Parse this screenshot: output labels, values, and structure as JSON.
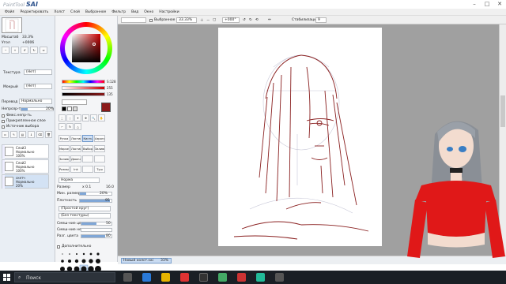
{
  "app": {
    "logo_small": "PaintTool",
    "logo_big": "SAI"
  },
  "window": {
    "minimize": "–",
    "maximize": "□",
    "close": "✕"
  },
  "menu": [
    "Файл",
    "Редактировать",
    "Холст",
    "Слой",
    "Выбранное",
    "Фильтр",
    "Вид",
    "Окно",
    "Настройки"
  ],
  "toolbar": {
    "selection_label": "Выбранное",
    "zoom": "33.33%",
    "rotation": "+000°",
    "stabilizer_label": "Стабилизация",
    "stabilizer_value": "9"
  },
  "navigator": {
    "scale_label": "Масштаб",
    "scale_value": "33.3%",
    "angle_label": "Угол",
    "angle_value": "+0006"
  },
  "texture": {
    "label": "Текстура",
    "value": "(Нет)"
  },
  "effect": {
    "label": "Мокрый",
    "value": "(Нет)"
  },
  "blend": {
    "mode_label": "Перевод",
    "mode_value": "Нормально",
    "opacity_label": "Непрозр-ть",
    "opacity_value": "20%",
    "opacity_level": 0.2
  },
  "checkboxes": {
    "protect": "Фикс.непр-ть",
    "clip": "Прикрепленное слое",
    "selection_source": "Источник выбора"
  },
  "layers": [
    {
      "name": "Слой3",
      "mode": "Нормально",
      "opacity": "100%",
      "selected": false
    },
    {
      "name": "Слой2",
      "mode": "Нормально",
      "opacity": "100%",
      "selected": false
    },
    {
      "name": "скетч",
      "mode": "Нормально",
      "opacity": "20%",
      "selected": true
    }
  ],
  "color": {
    "rgb_values": [
      "S:128",
      "255",
      "135"
    ],
    "current": "#8b1a1a",
    "secondary": "#000000"
  },
  "tools": {
    "row1": [
      "Ручка",
      "Ластик",
      "Кисть",
      "Аэрограф"
    ],
    "row2": [
      "Маркер",
      "Ластик",
      "Выбор",
      "Заливка"
    ],
    "row3": [
      "Заливка",
      "Двоичн.",
      "",
      ""
    ],
    "row4": [
      "Размыт",
      "Ink",
      "",
      "Туш"
    ]
  },
  "brush": {
    "mode_value": "Норма",
    "size_label": "Размер",
    "size_mult": "x 0.1",
    "size_value": "16.0",
    "min_size_label": "Мин. размер",
    "min_size_value": "20%",
    "density_label": "Плотность",
    "density_value": "95",
    "shape_value": "(Простой круг)",
    "texture_value": "(Без текстуры)",
    "blending_label": "Смеш-ние цв.",
    "blending_value": "50",
    "dilution_label": "Смеш-ние непр.",
    "dilution_value": "",
    "persistence_label": "Разг. цвета",
    "persistence_value": "80",
    "advanced_label": "Дополнительно",
    "size_presets": [
      "0.7",
      "0.8",
      "1",
      "1.5",
      "2",
      "2.3",
      "3",
      "3.5",
      "4",
      "5",
      "6",
      "7",
      "8",
      "9",
      "10",
      "12",
      "14",
      "16",
      "20"
    ]
  },
  "statusbar": {
    "doc_name": "Новый холст.sai",
    "zoom": "33%"
  },
  "taskbar": {
    "search": "Поиск"
  }
}
